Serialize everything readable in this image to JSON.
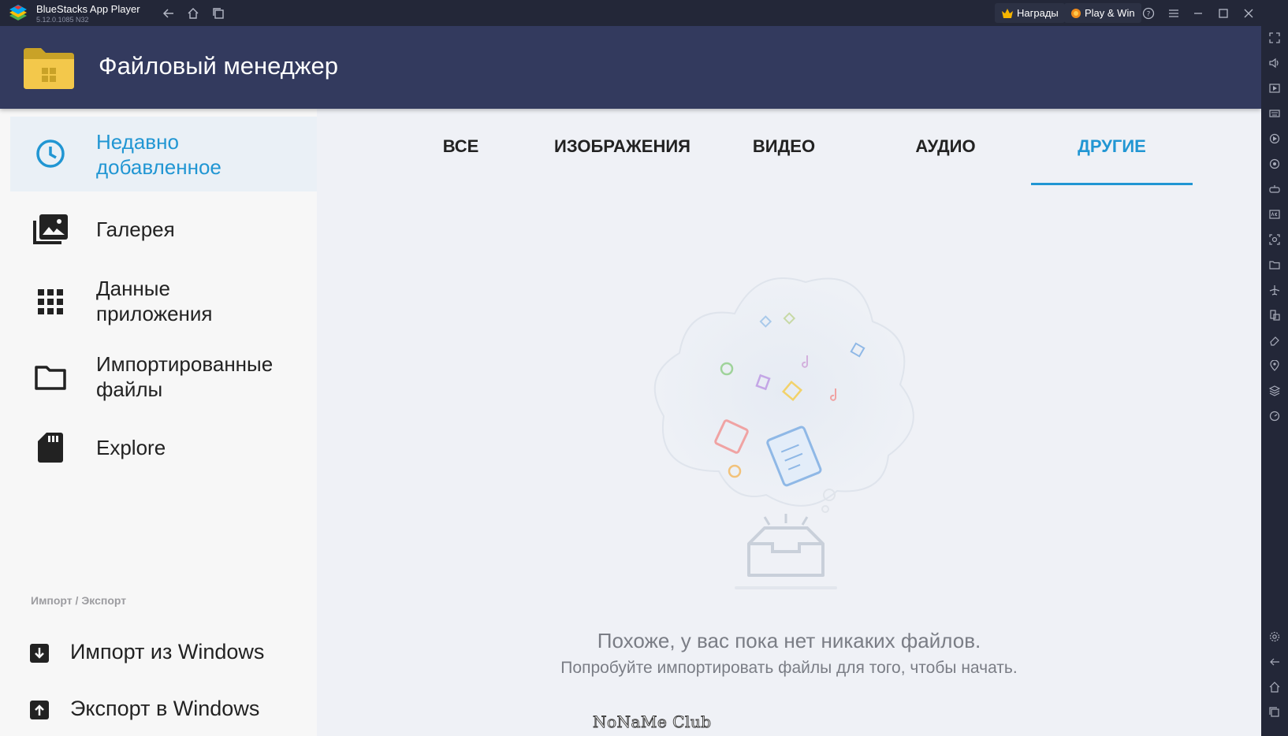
{
  "window": {
    "app_name": "BlueStacks App Player",
    "version": "5.12.0.1085 N32",
    "rewards_label": "Награды",
    "playwin_label": "Play & Win"
  },
  "app": {
    "title": "Файловый менеджер"
  },
  "sidebar": {
    "items": [
      {
        "label": "Недавно\nдобавленное",
        "icon": "clock-icon"
      },
      {
        "label": "Галерея",
        "icon": "gallery-icon"
      },
      {
        "label": "Данные\nприложения",
        "icon": "apps-grid-icon"
      },
      {
        "label": "Импортированные\nфайлы",
        "icon": "folder-icon"
      },
      {
        "label": "Explore",
        "icon": "sd-card-icon"
      }
    ],
    "section_caption": "Импорт / Экспорт",
    "import_label": "Импорт из Windows",
    "export_label": "Экспорт в Windows"
  },
  "tabs": [
    "ВСЕ",
    "ИЗОБРАЖЕНИЯ",
    "ВИДЕО",
    "АУДИО",
    "ДРУГИЕ"
  ],
  "active_tab": "ДРУГИЕ",
  "empty_state": {
    "title": "Похоже, у вас пока нет никаких файлов.",
    "subtitle": "Попробуйте импортировать файлы для того, чтобы начать."
  },
  "watermark": "NoNaMe Club",
  "colors": {
    "accent": "#2196d3",
    "appbar": "#333a5e",
    "titlebar": "#232738"
  }
}
